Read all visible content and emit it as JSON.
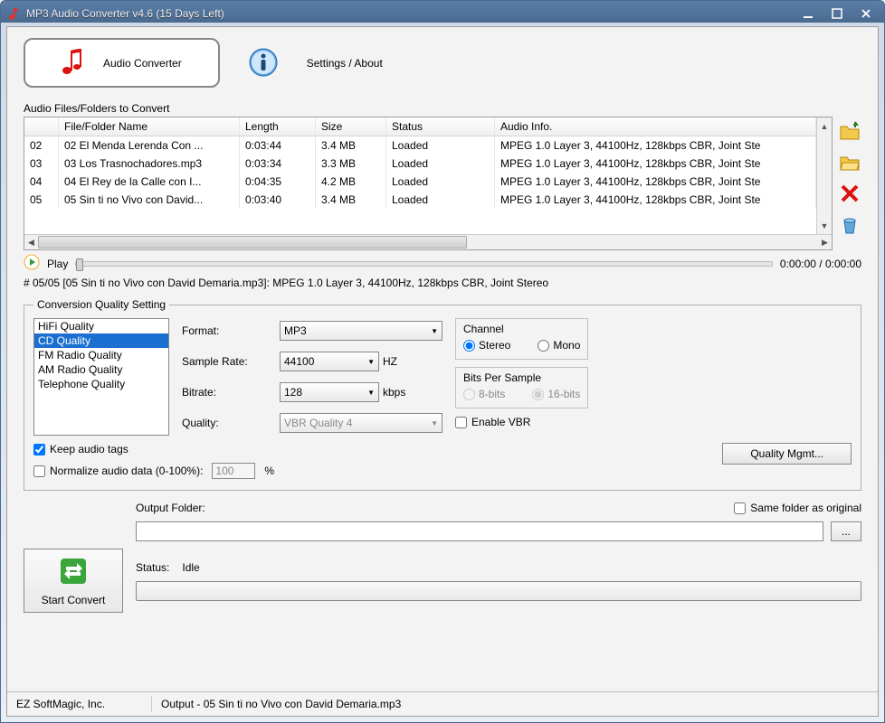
{
  "window": {
    "title": "MP3 Audio Converter v4.6 (15 Days Left)"
  },
  "toolbar": {
    "audio_converter_label": "Audio Converter",
    "settings_about_label": "Settings / About"
  },
  "files": {
    "section_label": "Audio Files/Folders to Convert",
    "columns": {
      "name": "File/Folder Name",
      "length": "Length",
      "size": "Size",
      "status": "Status",
      "info": "Audio Info."
    },
    "rows": [
      {
        "idx": "02",
        "name": "02 El Menda Lerenda Con ...",
        "length": "0:03:44",
        "size": "3.4 MB",
        "status": "Loaded",
        "info": "MPEG 1.0 Layer 3, 44100Hz, 128kbps CBR, Joint Ste"
      },
      {
        "idx": "03",
        "name": "03 Los Trasnochadores.mp3",
        "length": "0:03:34",
        "size": "3.3 MB",
        "status": "Loaded",
        "info": "MPEG 1.0 Layer 3, 44100Hz, 128kbps CBR, Joint Ste"
      },
      {
        "idx": "04",
        "name": "04 El Rey de la Calle con I...",
        "length": "0:04:35",
        "size": "4.2 MB",
        "status": "Loaded",
        "info": "MPEG 1.0 Layer 3, 44100Hz, 128kbps CBR, Joint Ste"
      },
      {
        "idx": "05",
        "name": "05 Sin ti no Vivo con David...",
        "length": "0:03:40",
        "size": "3.4 MB",
        "status": "Loaded",
        "info": "MPEG 1.0 Layer 3, 44100Hz, 128kbps CBR, Joint Ste"
      }
    ]
  },
  "play": {
    "label": "Play",
    "time": "0:00:00 / 0:00:00"
  },
  "current_file_line": "# 05/05 [05 Sin ti no Vivo con David Demaria.mp3]: MPEG 1.0 Layer 3, 44100Hz, 128kbps CBR, Joint Stereo",
  "quality": {
    "legend": "Conversion Quality Setting",
    "list": [
      "HiFi Quality",
      "CD Quality",
      "FM Radio Quality",
      "AM Radio Quality",
      "Telephone Quality"
    ],
    "selected_index": 1,
    "format_label": "Format:",
    "format_value": "MP3",
    "sample_rate_label": "Sample Rate:",
    "sample_rate_value": "44100",
    "sample_rate_unit": "HZ",
    "bitrate_label": "Bitrate:",
    "bitrate_value": "128",
    "bitrate_unit": "kbps",
    "quality_label": "Quality:",
    "quality_value": "VBR Quality 4",
    "channel_title": "Channel",
    "channel_stereo": "Stereo",
    "channel_mono": "Mono",
    "bits_title": "Bits Per Sample",
    "bits_8": "8-bits",
    "bits_16": "16-bits",
    "enable_vbr": "Enable VBR",
    "keep_tags": "Keep audio tags",
    "normalize": "Normalize audio data (0-100%):",
    "normalize_value": "100",
    "normalize_unit": "%",
    "quality_mgmt_btn": "Quality Mgmt..."
  },
  "output": {
    "folder_label": "Output Folder:",
    "same_folder_label": "Same folder as original",
    "browse_label": "...",
    "status_label": "Status:",
    "status_value": "Idle",
    "start_btn": "Start Convert"
  },
  "statusbar": {
    "company": "EZ SoftMagic, Inc.",
    "output": "Output - 05 Sin ti no Vivo con David Demaria.mp3"
  }
}
